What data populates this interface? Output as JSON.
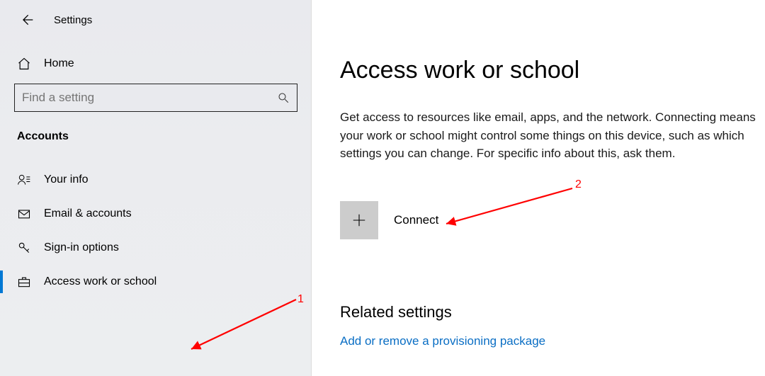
{
  "app": {
    "title": "Settings"
  },
  "sidebar": {
    "home": "Home",
    "search_placeholder": "Find a setting",
    "section": "Accounts",
    "items": [
      {
        "label": "Your info"
      },
      {
        "label": "Email & accounts"
      },
      {
        "label": "Sign-in options"
      },
      {
        "label": "Access work or school"
      }
    ]
  },
  "main": {
    "heading": "Access work or school",
    "description": "Get access to resources like email, apps, and the network. Connecting means your work or school might control some things on this device, such as which settings you can change. For specific info about this, ask them.",
    "connect_label": "Connect",
    "related_heading": "Related settings",
    "related_link": "Add or remove a provisioning package"
  },
  "annotations": {
    "label1": "1",
    "label2": "2"
  }
}
